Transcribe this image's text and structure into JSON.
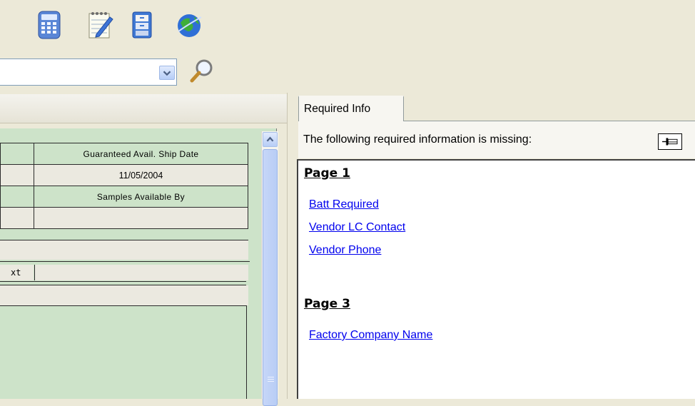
{
  "toolbar": {
    "icons": [
      "calculator-icon",
      "notepad-icon",
      "file-cabinet-icon",
      "globe-icon"
    ],
    "combo_value": "",
    "search_icon": "magnifier-icon"
  },
  "grid": {
    "guaranteed_ship_header": "Guaranteed Avail. Ship Date",
    "guaranteed_ship_value": "11/05/2004",
    "samples_header": "Samples Available By",
    "samples_value": "",
    "ext_label": "xt"
  },
  "right_panel": {
    "tab_label": "Required Info",
    "missing_text": "The following required information is missing:",
    "pin_icon": "pin-icon",
    "sections": [
      {
        "heading": "Page 1",
        "links": [
          "Batt Required",
          "Vendor LC Contact",
          "Vendor Phone"
        ]
      },
      {
        "heading": "Page 3",
        "links": [
          "Factory Company Name"
        ]
      }
    ]
  },
  "colors": {
    "grid_header_bg": "#cde3c9",
    "link": "#0000ee",
    "chrome": "#ece9d8"
  }
}
